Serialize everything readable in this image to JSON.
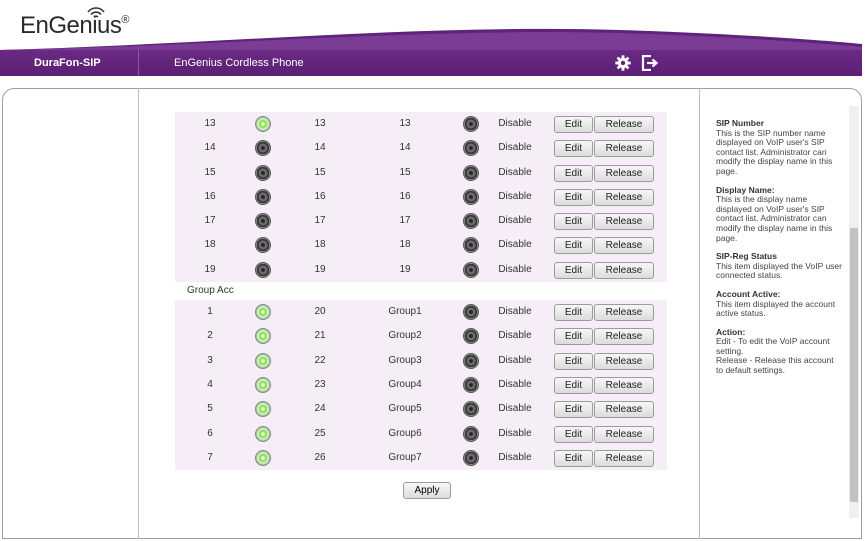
{
  "header": {
    "logo": "EnGenius",
    "logo_reg": "®",
    "product": "DuraFon-SIP",
    "subtitle": "EnGenius Cordless Phone",
    "brand_color": "#5e237a"
  },
  "table": {
    "rows_top": [
      {
        "index": "13",
        "sip_reg": "green",
        "sip_number": "13",
        "display_name": "13",
        "account_active": "grey",
        "status": "Disable"
      },
      {
        "index": "14",
        "sip_reg": "grey",
        "sip_number": "14",
        "display_name": "14",
        "account_active": "grey",
        "status": "Disable"
      },
      {
        "index": "15",
        "sip_reg": "grey",
        "sip_number": "15",
        "display_name": "15",
        "account_active": "grey",
        "status": "Disable"
      },
      {
        "index": "16",
        "sip_reg": "grey",
        "sip_number": "16",
        "display_name": "16",
        "account_active": "grey",
        "status": "Disable"
      },
      {
        "index": "17",
        "sip_reg": "grey",
        "sip_number": "17",
        "display_name": "17",
        "account_active": "grey",
        "status": "Disable"
      },
      {
        "index": "18",
        "sip_reg": "grey",
        "sip_number": "18",
        "display_name": "18",
        "account_active": "grey",
        "status": "Disable"
      },
      {
        "index": "19",
        "sip_reg": "grey",
        "sip_number": "19",
        "display_name": "19",
        "account_active": "grey",
        "status": "Disable"
      }
    ],
    "group_label": "Group Acc",
    "rows_group": [
      {
        "index": "1",
        "sip_reg": "green",
        "sip_number": "20",
        "display_name": "Group1",
        "account_active": "grey",
        "status": "Disable"
      },
      {
        "index": "2",
        "sip_reg": "green",
        "sip_number": "21",
        "display_name": "Group2",
        "account_active": "grey",
        "status": "Disable"
      },
      {
        "index": "3",
        "sip_reg": "green",
        "sip_number": "22",
        "display_name": "Group3",
        "account_active": "grey",
        "status": "Disable"
      },
      {
        "index": "4",
        "sip_reg": "green",
        "sip_number": "23",
        "display_name": "Group4",
        "account_active": "grey",
        "status": "Disable"
      },
      {
        "index": "5",
        "sip_reg": "green",
        "sip_number": "24",
        "display_name": "Group5",
        "account_active": "grey",
        "status": "Disable"
      },
      {
        "index": "6",
        "sip_reg": "green",
        "sip_number": "25",
        "display_name": "Group6",
        "account_active": "grey",
        "status": "Disable"
      },
      {
        "index": "7",
        "sip_reg": "green",
        "sip_number": "26",
        "display_name": "Group7",
        "account_active": "grey",
        "status": "Disable"
      }
    ],
    "edit_label": "Edit",
    "release_label": "Release"
  },
  "apply_label": "Apply",
  "help": {
    "sip_number_title": "SIP Number",
    "sip_number_text": "This is the SIP number name displayed on VoIP user's SIP contact list. Administrator can modify the display name in this page.",
    "display_name_title": "Display Name:",
    "display_name_text": "This is the display name displayed on VoIP user's SIP contact list. Administrator can modify the display name in this page.",
    "sip_reg_title": "SIP-Reg Status",
    "sip_reg_text": "This item displayed the VoIP user connected status.",
    "account_active_title": "Account Active:",
    "account_active_text": "This item displayed the account active status.",
    "action_title": "Action:",
    "action_edit": "Edit - To edit the VoIP account setting.",
    "action_release": "Release - Release this account to default settings."
  }
}
